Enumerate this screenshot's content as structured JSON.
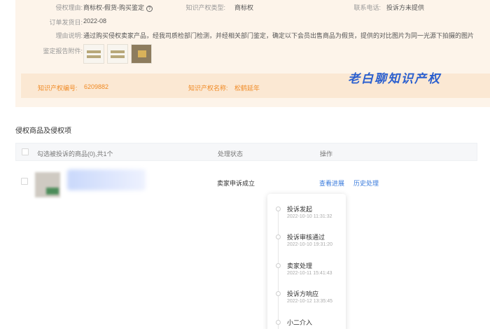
{
  "info": {
    "reason_label": "侵权理由:",
    "reason_value": "商标权-假货-购买鉴定",
    "ip_type_label": "知识产权类型:",
    "ip_type_value": "商标权",
    "contact_label": "联系电话:",
    "contact_value": "投诉方未提供",
    "date_label": "订单发货日:",
    "date_value": "2022-08",
    "desc_label": "理由说明:",
    "desc_value": "通过购买侵权卖家产品，经我司质检部门检测，并经相关部门鉴定，确定以下会员出售商品为假货，提供的对比图片为同一光源下拍摄的图片",
    "attach_label": "鉴定报告附件:",
    "ip_number_label": "知识产权编号:",
    "ip_number_value": "6209882",
    "ip_name_label": "知识产权名称:",
    "ip_name_value": "松鹤延年"
  },
  "watermark": "老白聊知识产权",
  "section": {
    "title": "侵权商品及侵权项",
    "col_select": "勾选被投诉的商品(0),共1个",
    "col_status": "处理状态",
    "col_action": "操作"
  },
  "row": {
    "status": "卖家申诉成立",
    "view_progress": "查看进展",
    "history": "历史处理"
  },
  "timeline": [
    {
      "label": "投诉发起",
      "time": "2022-10-10 11:31:32"
    },
    {
      "label": "投诉审核通过",
      "time": "2022-10-10 19:31:20"
    },
    {
      "label": "卖家处理",
      "time": "2022-10-11 15:41:43"
    },
    {
      "label": "投诉方响应",
      "time": "2022-10-12 13:35:45"
    },
    {
      "label": "小二介入",
      "time": ""
    }
  ]
}
